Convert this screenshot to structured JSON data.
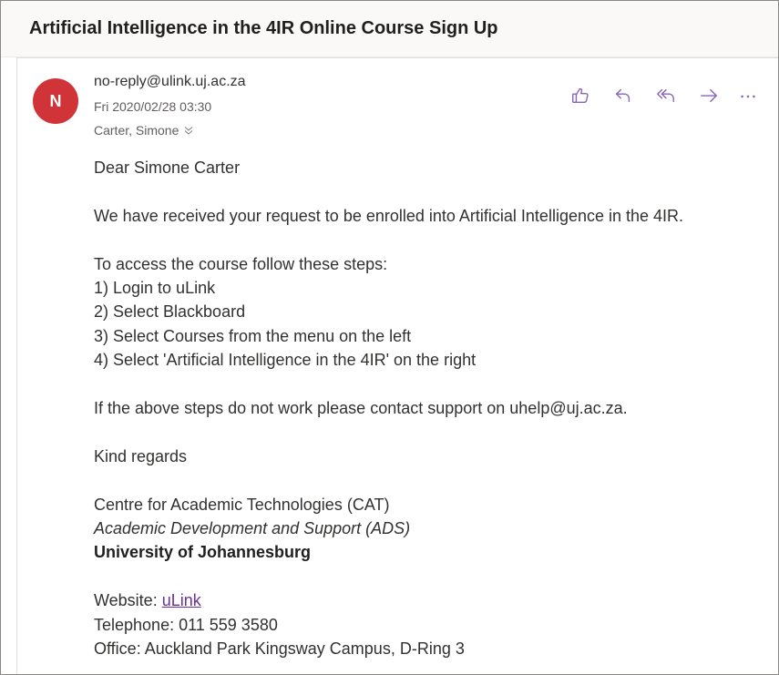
{
  "subject": "Artificial Intelligence in the 4IR Online Course Sign Up",
  "sender": {
    "initial": "N",
    "email": "no-reply@ulink.uj.ac.za",
    "date": "Fri 2020/02/28 03:30",
    "recipient": "Carter, Simone"
  },
  "actions": {
    "like_icon": "thumbs-up-icon",
    "reply_icon": "reply-icon",
    "reply_all_icon": "reply-all-icon",
    "forward_icon": "forward-icon",
    "more_icon": "more-icon",
    "more_label": "···"
  },
  "colors": {
    "accent": "#8764b8",
    "avatar": "#d13438",
    "link": "#6b2fa0"
  },
  "body": {
    "greeting": "Dear Simone Carter",
    "intro": "We have received your request to be enrolled into Artificial Intelligence in the 4IR.",
    "steps_intro": "To access the course follow these steps:",
    "steps": [
      "1) Login to uLink",
      "2) Select Blackboard",
      "3) Select Courses from the menu on the left",
      "4) Select 'Artificial Intelligence in the 4IR' on the right"
    ],
    "support": "If the above steps do not work please contact support on uhelp@uj.ac.za.",
    "closing": "Kind regards",
    "signature": {
      "centre": "Centre for Academic Technologies (CAT)",
      "department": "Academic Development and Support (ADS)",
      "university": "University of Johannesburg"
    },
    "contact": {
      "website_label": "Website: ",
      "website_link": "uLink",
      "telephone": "Telephone: 011 559 3580",
      "office": "Office: Auckland Park Kingsway Campus, D-Ring 3"
    }
  }
}
